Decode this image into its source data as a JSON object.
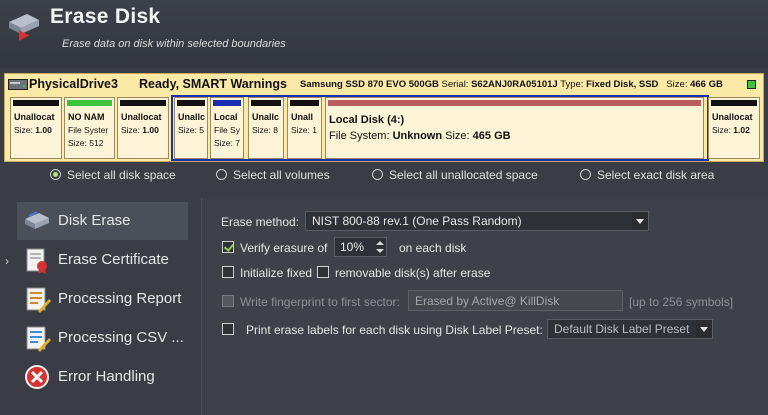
{
  "header": {
    "title": "Erase Disk",
    "subtitle": "Erase data on disk within selected boundaries",
    "icon": "erase-disk-icon"
  },
  "drive": {
    "name": "PhysicalDrive3",
    "status": "Ready, SMART Warnings",
    "model": "Samsung SSD 870 EVO 500GB",
    "serial_label": "Serial:",
    "serial": "S62ANJ0RA05101J",
    "type_label": "Type:",
    "type": "Fixed Disk, SSD",
    "size_label": "Size:",
    "size": "466 GB",
    "led_color": "#3bc43b"
  },
  "partitions": [
    {
      "l1": "Unallocat",
      "l2_prefix": "Size: ",
      "l2_value": "1.00",
      "bar": "#111111"
    },
    {
      "l1": "NO NAM",
      "l2_prefix": "File Syster",
      "l2_value": "",
      "l3": "Size: 512",
      "bar": "#3bc43b"
    },
    {
      "l1": "Unallocat",
      "l2_prefix": "Size: ",
      "l2_value": "1.00",
      "bar": "#111111"
    },
    {
      "l1": "Unallc",
      "l2_prefix": "Size: 5",
      "l2_value": "",
      "bar": "#111111"
    },
    {
      "l1": "Local",
      "l2_prefix": "File Sy",
      "l2_value": "",
      "l3": "Size: 7",
      "bar": "#1a2fb4"
    },
    {
      "l1": "Unallc",
      "l2_prefix": "Size: 8",
      "l2_value": "",
      "bar": "#111111"
    },
    {
      "l1": "Unall",
      "l2_prefix": "Size: 1",
      "l2_value": "",
      "bar": "#111111"
    },
    {
      "l1": "Local Disk (4:)",
      "l2_prefix": "File System: ",
      "l2_value": "Unknown",
      "l2_suffix": " Size: ",
      "l2_value2": "465 GB",
      "bar": "#b85c5c"
    },
    {
      "l1": "Unallocat",
      "l2_prefix": "Size: ",
      "l2_value": "1.02",
      "bar": "#111111"
    }
  ],
  "selection_options": [
    {
      "label": "Select all disk space",
      "selected": true
    },
    {
      "label": "Select all volumes",
      "selected": false
    },
    {
      "label": "Select all unallocated space",
      "selected": false
    },
    {
      "label": "Select exact disk area",
      "selected": false
    }
  ],
  "nav": [
    {
      "label": "Disk Erase",
      "icon": "disk-erase-icon",
      "active": true
    },
    {
      "label": "Erase Certificate",
      "icon": "certificate-icon",
      "active": false
    },
    {
      "label": "Processing Report",
      "icon": "report-icon",
      "active": false
    },
    {
      "label": "Processing CSV ...",
      "icon": "csv-icon",
      "active": false
    },
    {
      "label": "Error Handling",
      "icon": "error-icon",
      "active": false
    }
  ],
  "nav_expand_glyph": "›",
  "settings": {
    "erase_method_label": "Erase method:",
    "erase_method_value": "NIST 800-88 rev.1 (One Pass Random)",
    "verify_label": "Verify erasure of",
    "verify_value": "10%",
    "verify_suffix": "on each disk",
    "verify_checked": true,
    "init_fixed_label": "Initialize fixed",
    "init_fixed_checked": false,
    "removable_label": "removable disk(s) after erase",
    "removable_checked": false,
    "fingerprint_label": "Write fingerprint to first sector:",
    "fingerprint_value": "Erased by Active@ KillDisk",
    "fingerprint_hint": "[up to 256 symbols]",
    "fingerprint_enabled": false,
    "labels_label": "Print erase labels for each disk using Disk Label Preset:",
    "labels_checked": false,
    "preset_value": "Default Disk Label Preset"
  }
}
